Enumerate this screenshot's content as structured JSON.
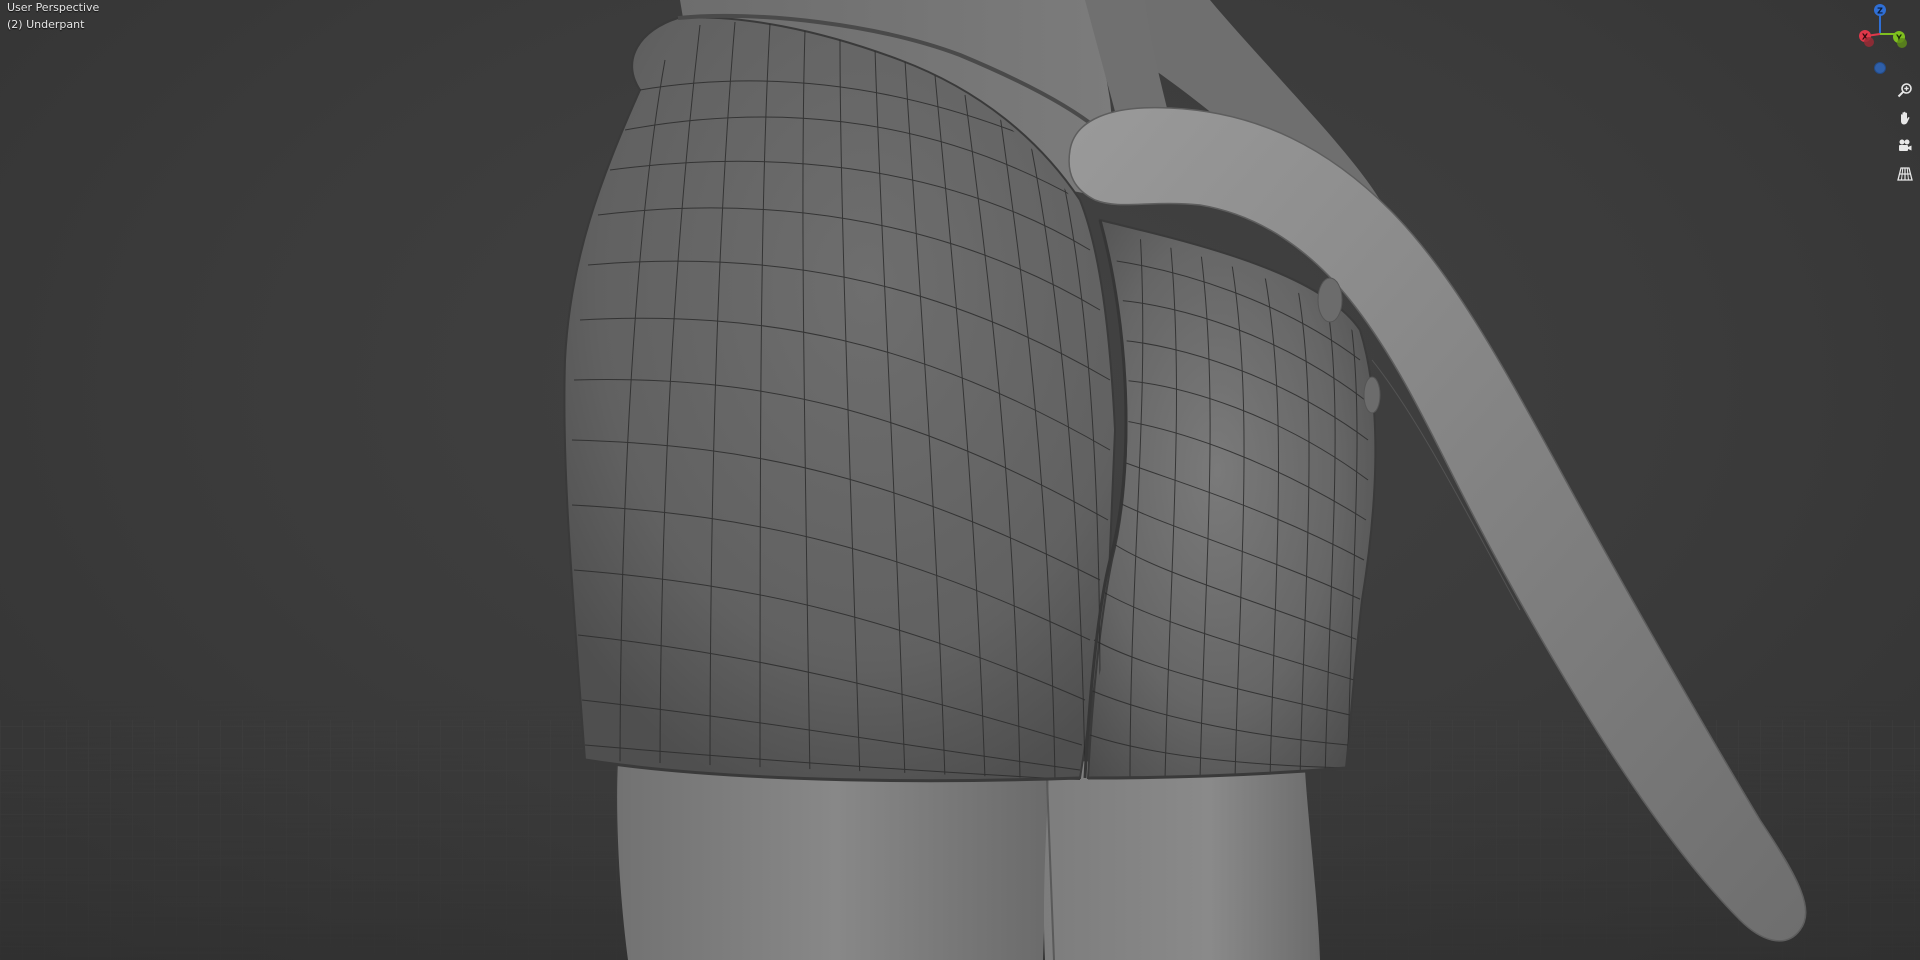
{
  "viewport": {
    "view_label": "User Perspective",
    "object_label": "(2) Underpant"
  },
  "gizmo": {
    "axes": [
      {
        "name": "Z",
        "label": "Z",
        "color": "#2f6fd6"
      },
      {
        "name": "Y",
        "label": "Y",
        "color": "#7fbf1f"
      },
      {
        "name": "X",
        "label": "X",
        "color": "#e0384a"
      }
    ],
    "negative_axis_color": "#2f5fa8"
  },
  "navigation": {
    "buttons": [
      {
        "name": "zoom",
        "icon": "zoom-icon"
      },
      {
        "name": "pan",
        "icon": "hand-icon"
      },
      {
        "name": "camera",
        "icon": "camera-icon"
      },
      {
        "name": "ortho",
        "icon": "grid-icon"
      }
    ]
  },
  "colors": {
    "background": "#3a3a3a",
    "mesh": "#7a7a7a",
    "wireframe": "#2c2c2c"
  }
}
